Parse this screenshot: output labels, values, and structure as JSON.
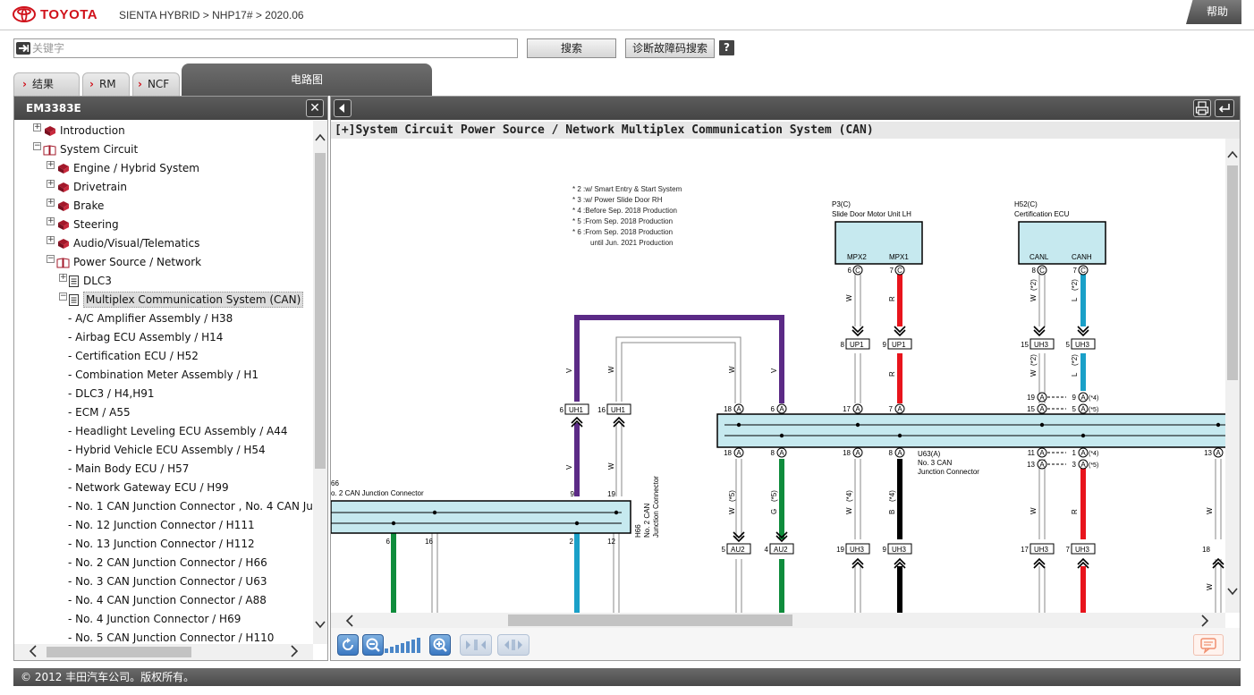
{
  "header": {
    "brand": "TOYOTA",
    "breadcrumb": "SIENTA HYBRID > NHP17# > 2020.06",
    "help": "帮助"
  },
  "search": {
    "placeholder": "关键字",
    "search_button": "搜索",
    "dtc_button": "诊断故障码搜索",
    "help_glyph": "?"
  },
  "tabs": [
    {
      "label": "结果"
    },
    {
      "label": "RM"
    },
    {
      "label": "NCF"
    },
    {
      "label": "电路图"
    }
  ],
  "left_panel": {
    "title": "EM3383E",
    "close_glyph": "✕",
    "tree": [
      {
        "label": "Introduction",
        "toggle": "+",
        "icon": "book"
      },
      {
        "label": "System Circuit",
        "toggle": "−",
        "icon": "book-open"
      },
      {
        "label": "Engine / Hybrid System",
        "toggle": "+",
        "icon": "book"
      },
      {
        "label": "Drivetrain",
        "toggle": "+",
        "icon": "book"
      },
      {
        "label": "Brake",
        "toggle": "+",
        "icon": "book"
      },
      {
        "label": "Steering",
        "toggle": "+",
        "icon": "book"
      },
      {
        "label": "Audio/Visual/Telematics",
        "toggle": "+",
        "icon": "book"
      },
      {
        "label": "Power Source / Network",
        "toggle": "−",
        "icon": "book-open"
      },
      {
        "label": "DLC3",
        "toggle": "+",
        "icon": "doc"
      },
      {
        "label": "Multiplex Communication System (CAN)",
        "toggle": "−",
        "icon": "doc"
      },
      {
        "label": "- A/C Amplifier Assembly / H38"
      },
      {
        "label": "- Airbag ECU Assembly / H14"
      },
      {
        "label": "- Certification ECU / H52"
      },
      {
        "label": "- Combination Meter Assembly / H1"
      },
      {
        "label": "- DLC3 / H4,H91"
      },
      {
        "label": "- ECM / A55"
      },
      {
        "label": "- Headlight Leveling ECU Assembly / A44"
      },
      {
        "label": "- Hybrid Vehicle ECU Assembly / H54"
      },
      {
        "label": "- Main Body ECU / H57"
      },
      {
        "label": "- Network Gateway ECU / H99"
      },
      {
        "label": "- No. 1 CAN Junction Connector , No. 4 CAN Junc"
      },
      {
        "label": "- No. 12 Junction Connector / H111"
      },
      {
        "label": "- No. 13 Junction Connector / H112"
      },
      {
        "label": "- No. 2 CAN Junction Connector / H66"
      },
      {
        "label": "- No. 3 CAN Junction Connector / U63"
      },
      {
        "label": "- No. 4 CAN Junction Connector / A88"
      },
      {
        "label": "- No. 4 Junction Connector / H69"
      },
      {
        "label": "- No. 5 CAN Junction Connector / H110"
      }
    ]
  },
  "diagram": {
    "title": "[+]System Circuit  Power Source / Network  Multiplex Communication System (CAN)",
    "notes": [
      "* 2 :w/ Smart Entry & Start System",
      "* 3 :w/ Power Slide Door RH",
      "* 4 :Before Sep. 2018 Production",
      "* 5 :From Sep. 2018 Production",
      "* 6 :From Sep. 2018 Production",
      "until Jun. 2021 Production"
    ],
    "p3_label": "P3(C)",
    "p3_name": "Slide Door Motor Unit LH",
    "p3_pin_mpx2": "MPX2",
    "p3_pin_mpx1": "MPX1",
    "h52_label": "H52(C)",
    "h52_name": "Certification ECU",
    "h52_pin_canl": "CANL",
    "h52_pin_canh": "CANH",
    "u63_label": "U63(A)",
    "u63_name1": "No. 3 CAN",
    "u63_name2": "Junction Connector",
    "h66_label": "66",
    "h66_name": "o. 2 CAN Junction Connector",
    "h66_vert1": "H66",
    "h66_vert2": "No. 2 CAN",
    "h66_vert3": "Junction Connector",
    "conn_uh1": "UH1",
    "conn_up1": "UP1",
    "conn_uh3": "UH3",
    "conn_au2": "AU2",
    "term_a": "A",
    "term_c": "C",
    "wire_w": "W",
    "wire_r": "R",
    "wire_l": "L",
    "wire_v": "V",
    "wire_g": "G",
    "wire_b": "B",
    "note_2": "(*2)",
    "note_4": "(*4)",
    "note_5": "(*5)",
    "pin_numbers": [
      "6",
      "16",
      "18",
      "8",
      "17",
      "7",
      "19",
      "15",
      "5",
      "9",
      "11",
      "1",
      "13",
      "3",
      "2",
      "12",
      "4"
    ]
  },
  "footer": {
    "copyright": "© 2012 丰田汽车公司。版权所有。"
  },
  "colors": {
    "brand_red": "#d0121b",
    "wire_violet": "#5b2a86",
    "wire_red": "#e8141c",
    "wire_blue": "#1aa0c8",
    "wire_green": "#0f8c3c",
    "wire_black": "#000000",
    "bus_fill": "#c6e9ef"
  }
}
